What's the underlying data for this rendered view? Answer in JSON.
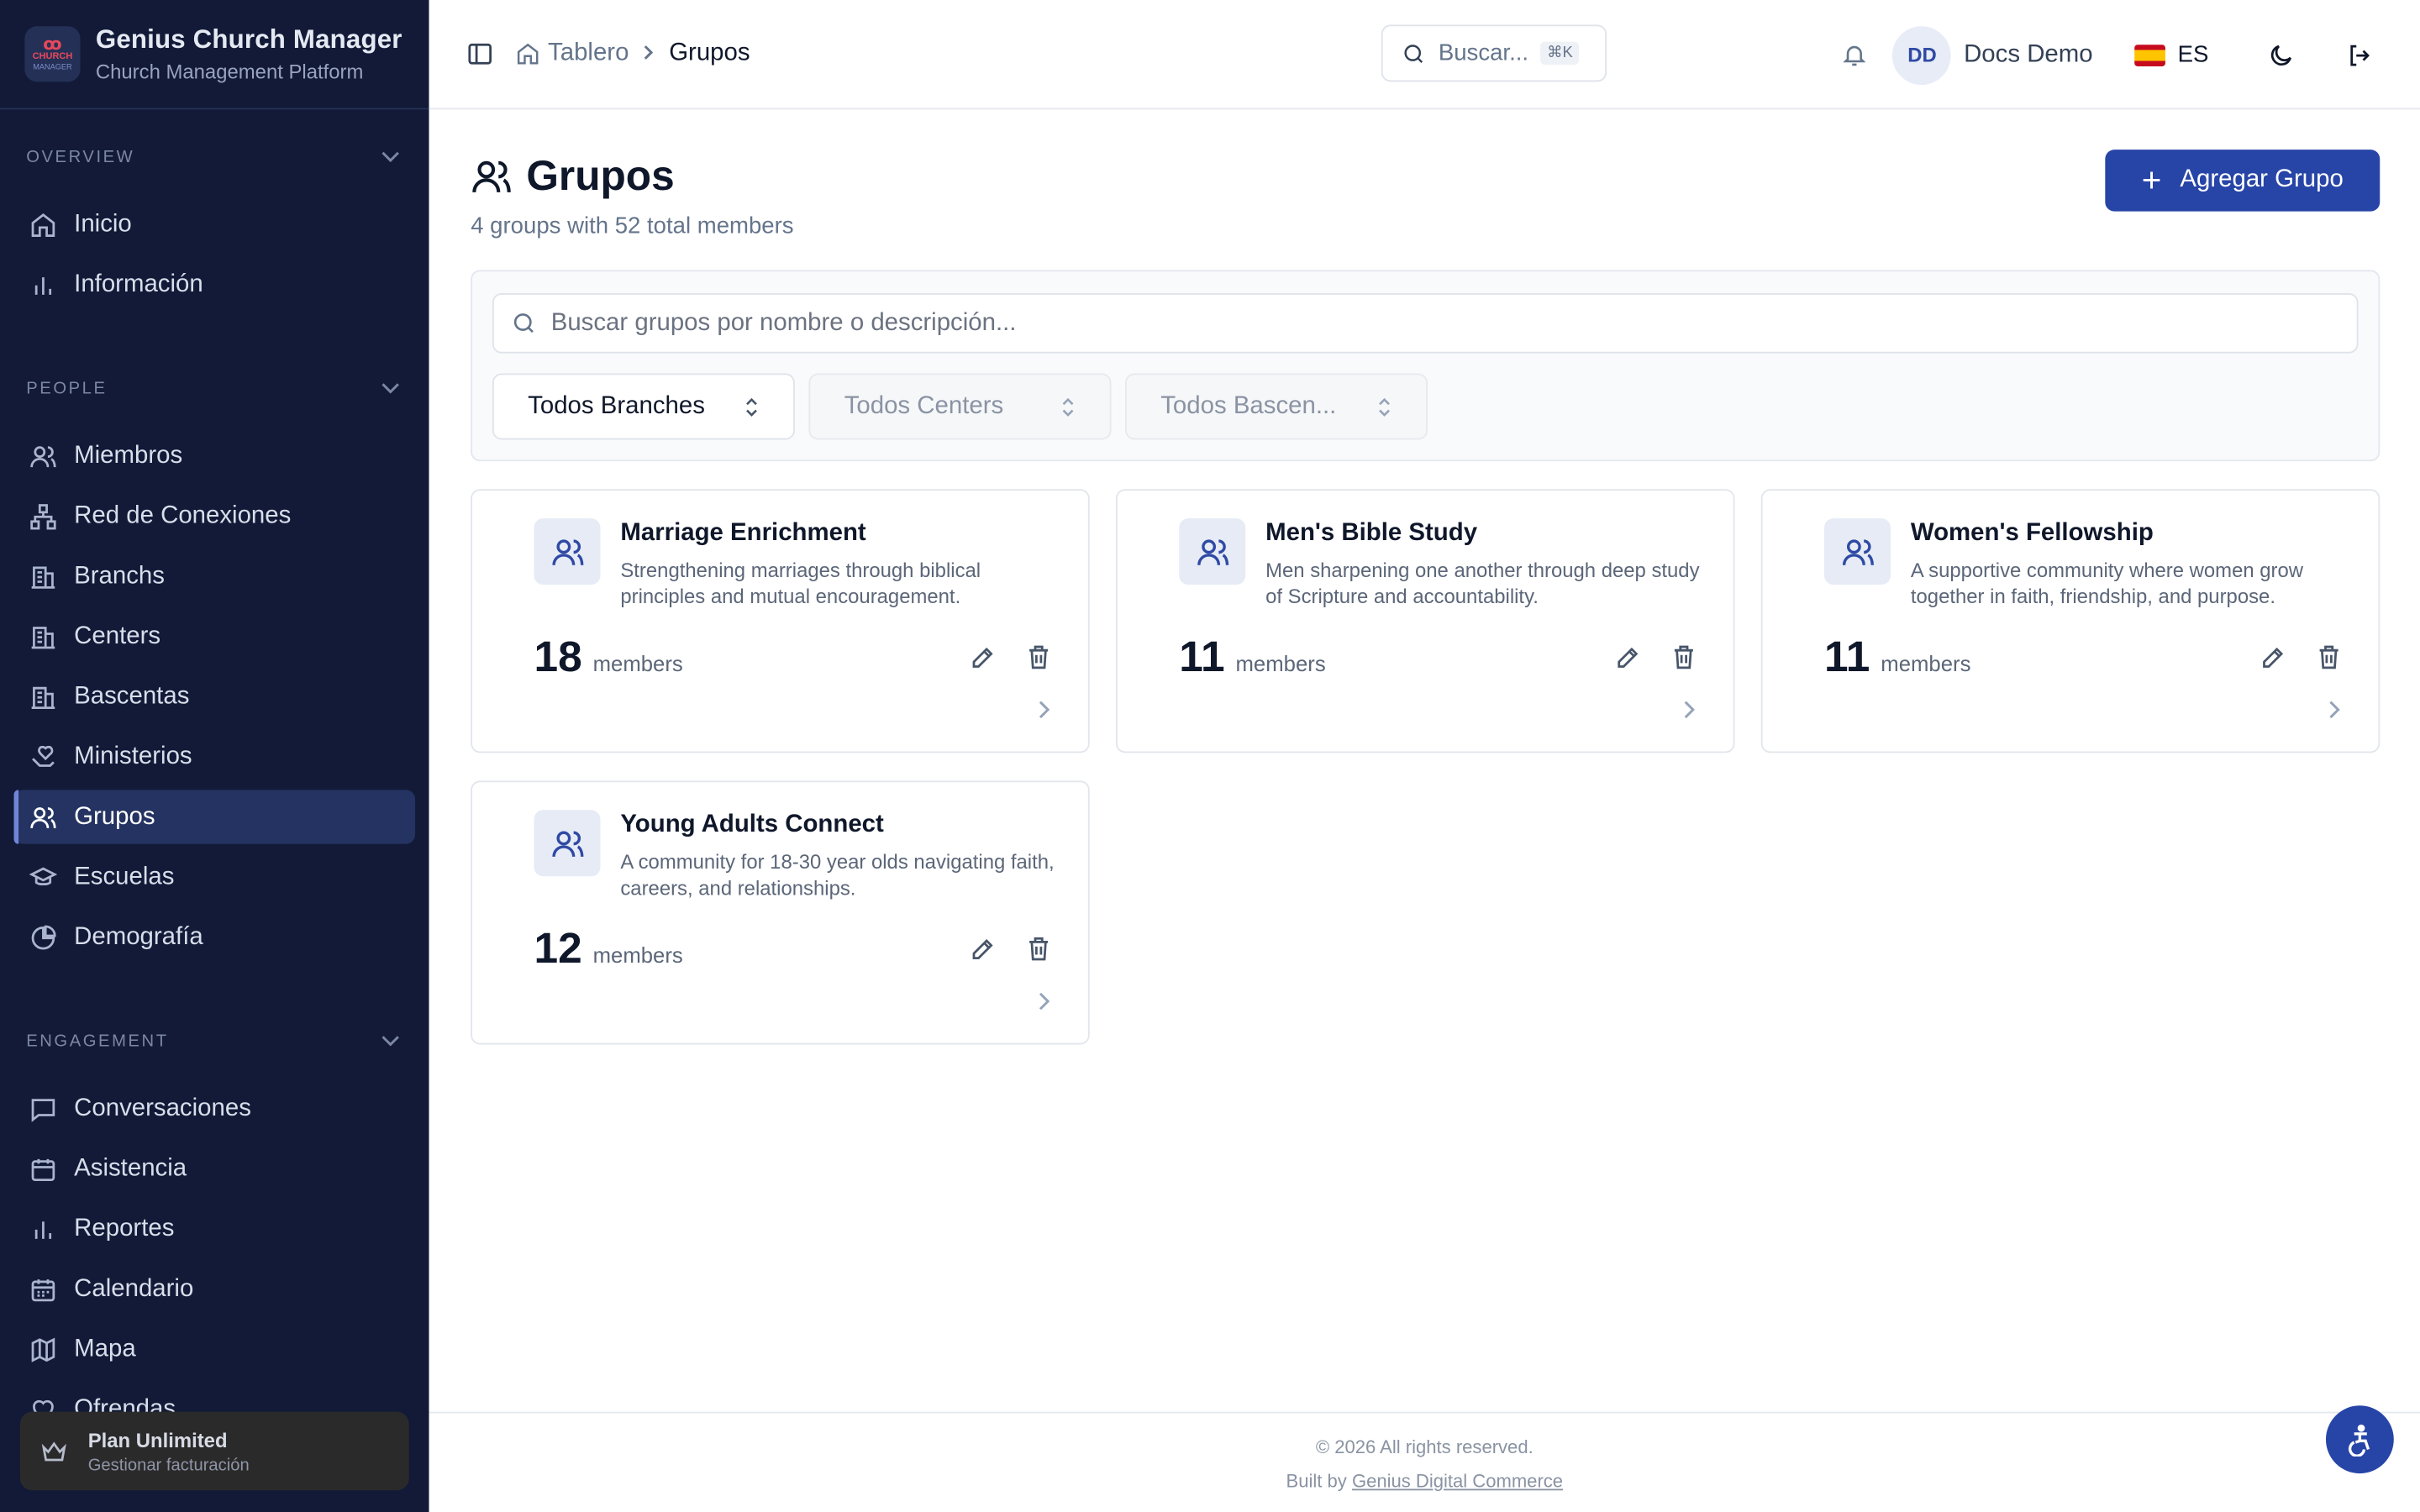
{
  "app": {
    "title": "Genius Church Manager",
    "subtitle": "Church Management Platform",
    "logo_line1": "CHURCH",
    "logo_line2": "MANAGER"
  },
  "sidebar": {
    "sections": [
      {
        "label": "OVERVIEW",
        "items": [
          {
            "label": "Inicio",
            "icon": "home-icon"
          },
          {
            "label": "Información",
            "icon": "bar-chart-icon"
          }
        ]
      },
      {
        "label": "PEOPLE",
        "items": [
          {
            "label": "Miembros",
            "icon": "users-icon"
          },
          {
            "label": "Red de Conexiones",
            "icon": "network-icon"
          },
          {
            "label": "Branchs",
            "icon": "building-icon"
          },
          {
            "label": "Centers",
            "icon": "building-icon"
          },
          {
            "label": "Bascentas",
            "icon": "building-icon"
          },
          {
            "label": "Ministerios",
            "icon": "hand-heart-icon"
          },
          {
            "label": "Grupos",
            "icon": "users-icon",
            "active": true
          },
          {
            "label": "Escuelas",
            "icon": "graduation-cap-icon"
          },
          {
            "label": "Demografía",
            "icon": "pie-chart-icon"
          }
        ]
      },
      {
        "label": "ENGAGEMENT",
        "items": [
          {
            "label": "Conversaciones",
            "icon": "message-square-icon"
          },
          {
            "label": "Asistencia",
            "icon": "calendar-check-icon"
          },
          {
            "label": "Reportes",
            "icon": "bar-chart-icon"
          },
          {
            "label": "Calendario",
            "icon": "calendar-icon"
          },
          {
            "label": "Mapa",
            "icon": "map-icon"
          },
          {
            "label": "Ofrendas",
            "icon": "heart-icon"
          }
        ]
      }
    ],
    "plan": {
      "title": "Plan Unlimited",
      "subtitle": "Gestionar facturación"
    }
  },
  "topbar": {
    "breadcrumb": [
      "Tablero",
      "Grupos"
    ],
    "search_placeholder": "Buscar...",
    "search_shortcut": "⌘K",
    "user_initials": "DD",
    "user_name": "Docs Demo",
    "language": "ES"
  },
  "page": {
    "title": "Grupos",
    "subtitle": "4 groups with 52 total members",
    "add_button": "Agregar Grupo",
    "search_placeholder": "Buscar grupos por nombre o descripción...",
    "filters": [
      "Todos Branches",
      "Todos Centers",
      "Todos Bascen..."
    ]
  },
  "groups": [
    {
      "name": "Marriage Enrichment",
      "description": "Strengthening marriages through biblical principles and mutual encouragement.",
      "count": "18",
      "count_label": "members"
    },
    {
      "name": "Men's Bible Study",
      "description": "Men sharpening one another through deep study of Scripture and accountability.",
      "count": "11",
      "count_label": "members"
    },
    {
      "name": "Women's Fellowship",
      "description": "A supportive community where women grow together in faith, friendship, and purpose.",
      "count": "11",
      "count_label": "members"
    },
    {
      "name": "Young Adults Connect",
      "description": "A community for 18-30 year olds navigating faith, careers, and relationships.",
      "count": "12",
      "count_label": "members"
    }
  ],
  "footer": {
    "copyright": "© 2026 All rights reserved.",
    "built_by_prefix": "Built by",
    "built_by_link": "Genius Digital Commerce"
  },
  "colors": {
    "sidebar_bg": "#121a38",
    "accent": "#2745a7",
    "active_item_bg": "#243361"
  }
}
